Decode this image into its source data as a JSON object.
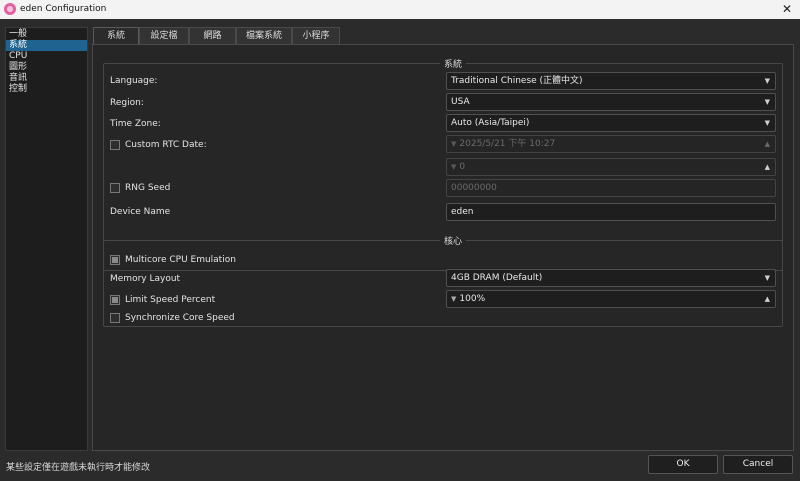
{
  "window": {
    "title": "eden Configuration",
    "close_glyph": "✕",
    "app_icon": "eden-logo-icon"
  },
  "sidebar": {
    "items": [
      {
        "label": "一般"
      },
      {
        "label": "系統"
      },
      {
        "label": "CPU"
      },
      {
        "label": "圖形"
      },
      {
        "label": "音訊"
      },
      {
        "label": "控制"
      }
    ],
    "selected_index": 1
  },
  "tabs": [
    {
      "label": "系統"
    },
    {
      "label": "設定檔"
    },
    {
      "label": "網路"
    },
    {
      "label": "檔案系統"
    },
    {
      "label": "小程序"
    }
  ],
  "system_group": {
    "title": "系統",
    "language": {
      "label": "Language:",
      "value": "Traditional Chinese (正體中文)"
    },
    "region": {
      "label": "Region:",
      "value": "USA"
    },
    "time_zone": {
      "label": "Time Zone:",
      "value": "Auto (Asia/Taipei)"
    },
    "custom_rtc": {
      "label": "Custom RTC Date:",
      "value": "2025/5/21 下午 10:27",
      "checked": false
    },
    "rtc_offset": {
      "value": "0"
    },
    "rng_seed": {
      "label": "RNG Seed",
      "value": "00000000",
      "checked": false
    },
    "device_name": {
      "label": "Device Name",
      "value": "eden"
    }
  },
  "core_group": {
    "title": "核心",
    "multicore": {
      "label": "Multicore CPU Emulation",
      "checked": true
    },
    "memory_layout": {
      "label": "Memory Layout",
      "value": "4GB DRAM (Default)"
    },
    "limit_speed": {
      "label": "Limit Speed Percent",
      "value": "100%",
      "checked": true
    },
    "sync_core": {
      "label": "Synchronize Core Speed",
      "checked": false
    }
  },
  "footer": {
    "status_text": "某些設定僅在遊戲未執行時才能修改",
    "ok_label": "OK",
    "cancel_label": "Cancel"
  },
  "glyphs": {
    "dropdown": "▼",
    "spin_up": "▲",
    "spin_down": "▼"
  }
}
